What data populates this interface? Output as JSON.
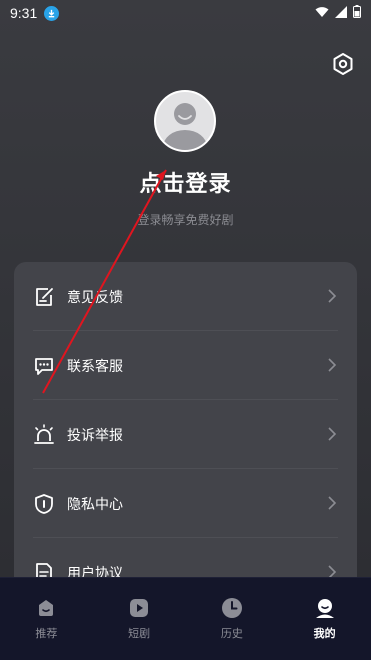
{
  "status_bar": {
    "time": "9:31"
  },
  "profile": {
    "login_title": "点击登录",
    "login_subtitle": "登录畅享免费好剧"
  },
  "menu": {
    "items": [
      {
        "label": "意见反馈",
        "icon": "feedback-icon"
      },
      {
        "label": "联系客服",
        "icon": "chat-icon"
      },
      {
        "label": "投诉举报",
        "icon": "alarm-icon"
      },
      {
        "label": "隐私中心",
        "icon": "shield-icon"
      },
      {
        "label": "用户协议",
        "icon": "document-icon"
      }
    ]
  },
  "tabs": [
    {
      "label": "推荐",
      "icon": "home-icon",
      "active": false
    },
    {
      "label": "短剧",
      "icon": "play-icon",
      "active": false
    },
    {
      "label": "历史",
      "icon": "clock-icon",
      "active": false
    },
    {
      "label": "我的",
      "icon": "profile-icon",
      "active": true
    }
  ],
  "colors": {
    "background": "#333439",
    "card": "#43444a",
    "tab_bar": "#14162a",
    "annotation_arrow": "#e0151f"
  }
}
